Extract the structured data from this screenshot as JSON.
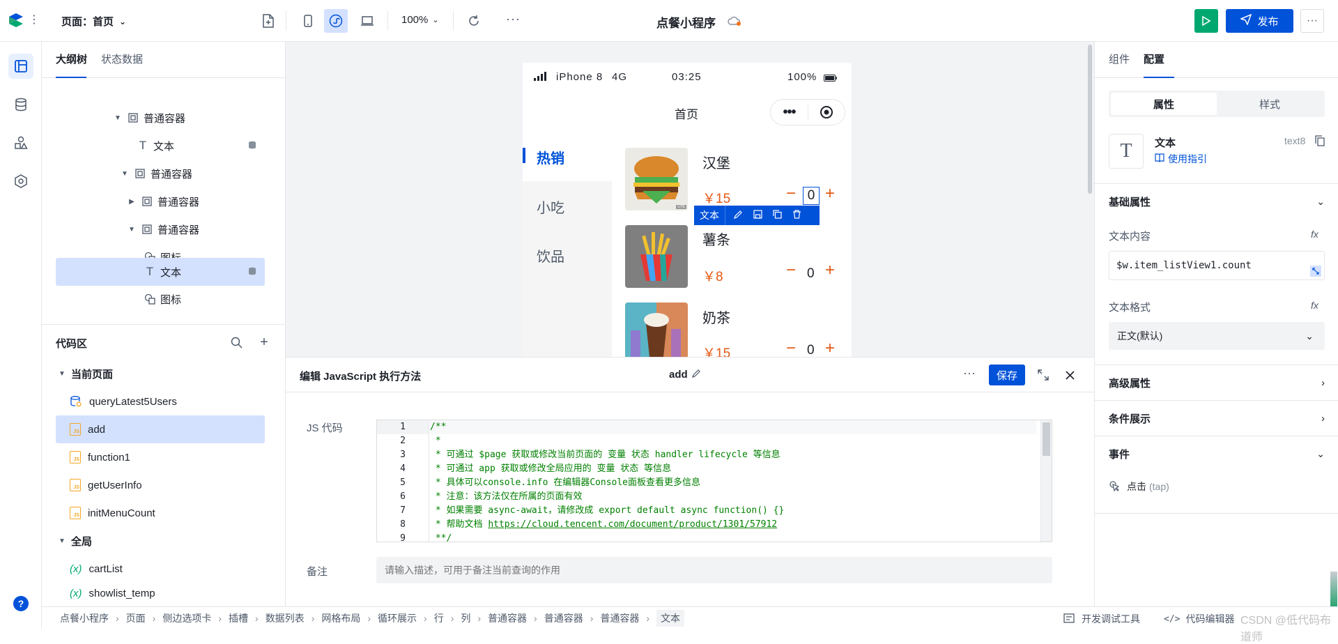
{
  "topbar": {
    "page_label": "页面：首页",
    "zoom": "100%",
    "app_title": "点餐小程序",
    "publish_label": "发布"
  },
  "outline": {
    "tabs": [
      "大纲树",
      "状态数据"
    ],
    "nodes": [
      {
        "label": "普通容器"
      },
      {
        "label": "文本"
      },
      {
        "label": "普通容器"
      },
      {
        "label": "普通容器"
      },
      {
        "label": "普通容器"
      },
      {
        "label": "图标"
      },
      {
        "label": "文本"
      },
      {
        "label": "图标"
      }
    ]
  },
  "code_area": {
    "title": "代码区",
    "group_page": "当前页面",
    "page_items": [
      "queryLatest5Users",
      "add",
      "function1",
      "getUserInfo",
      "initMenuCount"
    ],
    "group_global": "全局",
    "global_items": [
      "cartList",
      "showlist_temp"
    ]
  },
  "phone": {
    "device": "iPhone 8",
    "network": "4G",
    "time": "03:25",
    "battery": "100%",
    "page_title": "首页",
    "categories": [
      "热销",
      "小吃",
      "饮品"
    ],
    "items": [
      {
        "name": "汉堡",
        "price": "￥15",
        "count": "0"
      },
      {
        "name": "薯条",
        "price": "￥8",
        "count": "0"
      },
      {
        "name": "奶茶",
        "price": "￥15",
        "count": "0"
      }
    ],
    "selected_tag": "文本",
    "badge": "LITE"
  },
  "editor": {
    "title": "编辑 JavaScript 执行方法",
    "method_name": "add",
    "save_label": "保存",
    "js_label": "JS 代码",
    "code_lines": [
      "/**",
      " *",
      " * 可通过 $page 获取或修改当前页面的 变量 状态 handler lifecycle 等信息",
      " * 可通过 app 获取或修改全局应用的 变量 状态 等信息",
      " * 具体可以console.info 在编辑器Console面板查看更多信息",
      " * 注意：该方法仅在所属的页面有效",
      " * 如果需要 async-await，请修改成 export default async function() {}",
      " * 帮助文档 ",
      " **/"
    ],
    "help_link": "https://cloud.tencent.com/document/product/1301/57912",
    "line_numbers": [
      "1",
      "2",
      "3",
      "4",
      "5",
      "6",
      "7",
      "8",
      "9"
    ],
    "note_label": "备注",
    "note_placeholder": "请输入描述，可用于备注当前查询的作用"
  },
  "right_panel": {
    "tabs": [
      "组件",
      "配置"
    ],
    "segments": [
      "属性",
      "样式"
    ],
    "component_name": "文本",
    "component_id": "text8",
    "guide_link": "使用指引",
    "basic_props": "基础属性",
    "text_content_label": "文本内容",
    "text_content_value": "$w.item_listView1.count",
    "text_format_label": "文本格式",
    "text_format_value": "正文(默认)",
    "advanced": "高级属性",
    "conditional": "条件展示",
    "events": "事件",
    "event_tap": "点击",
    "event_tap_en": "(tap)",
    "fx": "fx"
  },
  "statusbar": {
    "crumbs": [
      "点餐小程序",
      "页面",
      "侧边选项卡",
      "插槽",
      "数据列表",
      "网格布局",
      "循环展示",
      "行",
      "列",
      "普通容器",
      "普通容器",
      "普通容器",
      "文本"
    ],
    "dev_tools": "开发调试工具",
    "code_editor": "代码编辑器",
    "watermark": "CSDN @低代码布道师"
  }
}
